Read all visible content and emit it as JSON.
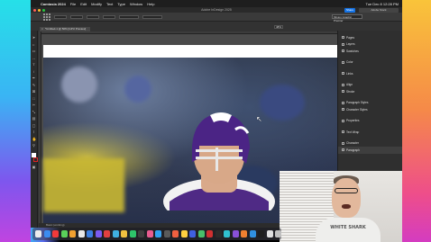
{
  "menubar": {
    "app_name": "Camtasia 2024",
    "items": [
      "File",
      "Edit",
      "Modify",
      "Text",
      "Type",
      "Window",
      "Help"
    ],
    "clock": "Tue Dec 8 12:28 PM"
  },
  "titlebar": {
    "title": "Adobe InDesign 2025",
    "share_label": "Share",
    "search_placeholder": "Adobe Stock"
  },
  "control_bar": {
    "font_field": "Minion Graphic Premier",
    "zoom": "48%"
  },
  "document_tab": {
    "label": "*Untitled-1 @ 50% [GPU Preview]",
    "close": "×"
  },
  "status_bar": {
    "text": "Basic (working)"
  },
  "panels": {
    "groups": [
      [
        "Pages",
        "Layers",
        "Swatches"
      ],
      [
        "Color"
      ],
      [
        "Links"
      ],
      [
        "Align",
        "Stroke"
      ],
      [
        "Paragraph Styles",
        "Character Styles"
      ],
      [
        "Properties"
      ],
      [
        "Text Wrap"
      ],
      [
        "Character",
        "Paragraph"
      ]
    ]
  },
  "webcam": {
    "shirt_text": "WHITE SHARK"
  },
  "dock": {
    "icon_colors": [
      "#ececec",
      "#3b8cf0",
      "#f23a3a",
      "#5ad05a",
      "#f0a030",
      "#e8e8e8",
      "#3a7de0",
      "#7a5af0",
      "#e14040",
      "#40b0e0",
      "#f0c040",
      "#2ec46a",
      "#3f3f3f",
      "#e85c90",
      "#30a0f0",
      "#5a5a5a",
      "#f06040",
      "#ffd040",
      "#4060e0",
      "#49c06a",
      "#d03030",
      "#2b2b2b",
      "#30c0d0",
      "#8a50d8",
      "#f08030",
      "#3090e0",
      "#1e1e1e",
      "#e0e0e0",
      "#c0c0c0"
    ]
  }
}
